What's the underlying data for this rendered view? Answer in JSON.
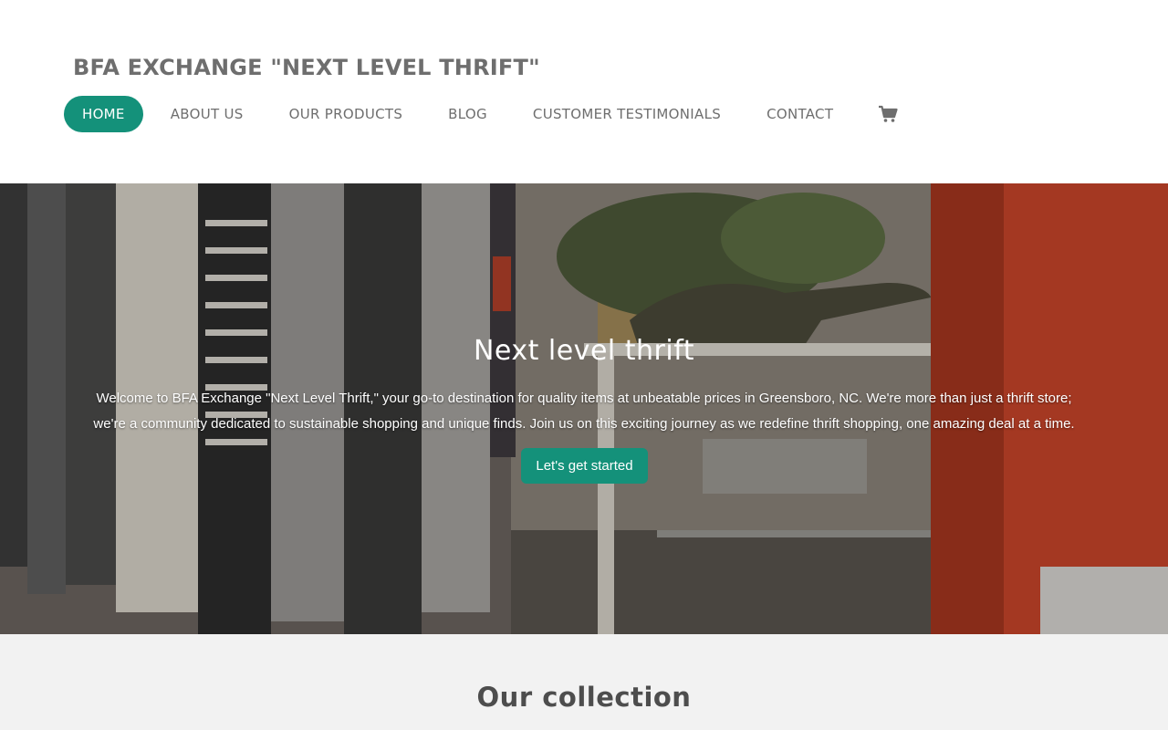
{
  "site": {
    "title": "BFA EXCHANGE \"NEXT LEVEL THRIFT\""
  },
  "nav": {
    "items": [
      {
        "label": "HOME",
        "active": true
      },
      {
        "label": "ABOUT US",
        "active": false
      },
      {
        "label": "OUR PRODUCTS",
        "active": false
      },
      {
        "label": "BLOG",
        "active": false
      },
      {
        "label": "CUSTOMER TESTIMONIALS",
        "active": false
      },
      {
        "label": "CONTACT",
        "active": false
      }
    ],
    "cart_icon": "shopping-cart-icon"
  },
  "hero": {
    "title": "Next level thrift",
    "text": "Welcome to BFA Exchange \"Next Level Thrift,\" your go-to destination for quality items at unbeatable prices in Greensboro, NC. We're more than just a thrift store; we're a community dedicated to sustainable shopping and unique finds. Join us on this exciting journey as we redefine thrift shopping, one amazing deal at a time.",
    "cta_label": "Let's get started"
  },
  "collection": {
    "title": "Our collection"
  },
  "colors": {
    "accent": "#14917a",
    "header_text": "#6e6e6e",
    "section_bg": "#f2f2f2"
  }
}
